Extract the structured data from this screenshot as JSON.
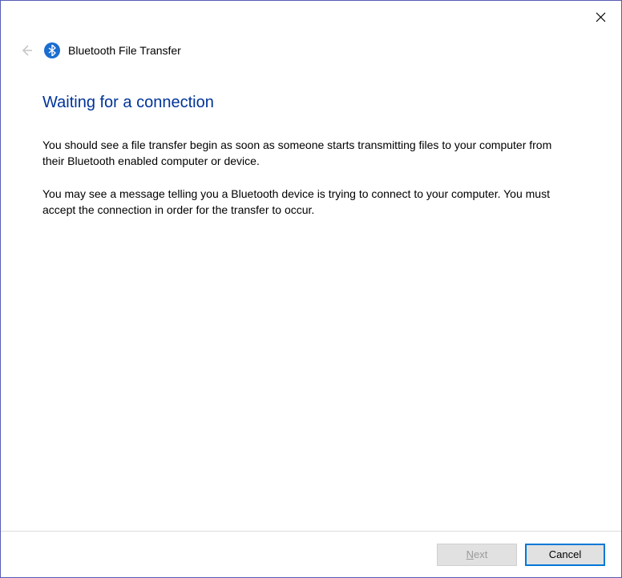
{
  "window": {
    "title": "Bluetooth File Transfer"
  },
  "page": {
    "heading": "Waiting for a connection",
    "paragraph1": "You should see a file transfer begin as soon as someone starts transmitting files to your computer from their Bluetooth enabled computer or device.",
    "paragraph2": "You may see a message telling you a Bluetooth device is trying to connect to your computer. You must accept the connection in order for the transfer to occur."
  },
  "footer": {
    "next_prefix": "N",
    "next_suffix": "ext",
    "cancel_label": "Cancel"
  }
}
